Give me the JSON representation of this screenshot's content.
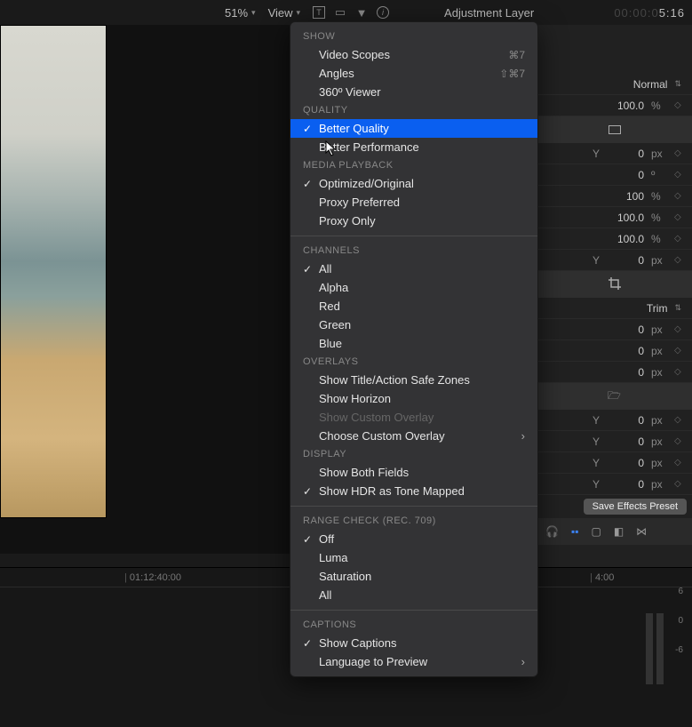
{
  "toolbar": {
    "zoom": "51%",
    "view_label": "View",
    "title": "Adjustment Layer",
    "timecode_dim": "00:00:0",
    "timecode_active": "5:16"
  },
  "inspector": {
    "blend_label": "Normal",
    "opacity_val": "100.0",
    "opacity_unit": "%",
    "rows": [
      {
        "y": "Y",
        "val": "0",
        "unit": "px"
      },
      {
        "y": "",
        "val": "0",
        "unit": "º"
      },
      {
        "y": "",
        "val": "100",
        "unit": "%"
      },
      {
        "y": "",
        "val": "100.0",
        "unit": "%"
      },
      {
        "y": "",
        "val": "100.0",
        "unit": "%"
      },
      {
        "y": "Y",
        "val": "0",
        "unit": "px"
      }
    ],
    "trim_label": "Trim",
    "trim_rows": [
      {
        "val": "0",
        "unit": "px"
      },
      {
        "val": "0",
        "unit": "px"
      },
      {
        "val": "0",
        "unit": "px"
      }
    ],
    "pos_rows": [
      {
        "y": "Y",
        "val": "0",
        "unit": "px"
      },
      {
        "y": "Y",
        "val": "0",
        "unit": "px"
      },
      {
        "y": "Y",
        "val": "0",
        "unit": "px"
      },
      {
        "y": "Y",
        "val": "0",
        "unit": "px"
      }
    ],
    "save_label": "Save Effects Preset"
  },
  "timeline": {
    "t1": "01:12:40:00",
    "t2": "4:00"
  },
  "audio_meter": {
    "l1": "6",
    "l2": "0",
    "l3": "-6"
  },
  "menu": {
    "sections": {
      "show": {
        "header": "SHOW",
        "items": [
          {
            "label": "Video Scopes",
            "shortcut": "⌘7"
          },
          {
            "label": "Angles",
            "shortcut": "⇧⌘7"
          },
          {
            "label": "360º Viewer"
          }
        ]
      },
      "quality": {
        "header": "QUALITY",
        "items": [
          {
            "label": "Better Quality",
            "checked": true,
            "selected": true
          },
          {
            "label": "Better Performance"
          }
        ]
      },
      "media": {
        "header": "MEDIA PLAYBACK",
        "items": [
          {
            "label": "Optimized/Original",
            "checked": true
          },
          {
            "label": "Proxy Preferred"
          },
          {
            "label": "Proxy Only"
          }
        ]
      },
      "channels": {
        "header": "CHANNELS",
        "items": [
          {
            "label": "All",
            "checked": true
          },
          {
            "label": "Alpha"
          },
          {
            "label": "Red"
          },
          {
            "label": "Green"
          },
          {
            "label": "Blue"
          }
        ]
      },
      "overlays": {
        "header": "OVERLAYS",
        "items": [
          {
            "label": "Show Title/Action Safe Zones"
          },
          {
            "label": "Show Horizon"
          },
          {
            "label": "Show Custom Overlay",
            "disabled": true
          },
          {
            "label": "Choose Custom Overlay",
            "submenu": true
          }
        ]
      },
      "display": {
        "header": "DISPLAY",
        "items": [
          {
            "label": "Show Both Fields"
          },
          {
            "label": "Show HDR as Tone Mapped",
            "checked": true
          }
        ]
      },
      "range": {
        "header": "RANGE CHECK (Rec. 709)",
        "items": [
          {
            "label": "Off",
            "checked": true
          },
          {
            "label": "Luma"
          },
          {
            "label": "Saturation"
          },
          {
            "label": "All"
          }
        ]
      },
      "captions": {
        "header": "CAPTIONS",
        "items": [
          {
            "label": "Show Captions",
            "checked": true
          },
          {
            "label": "Language to Preview",
            "submenu": true
          }
        ]
      }
    }
  }
}
